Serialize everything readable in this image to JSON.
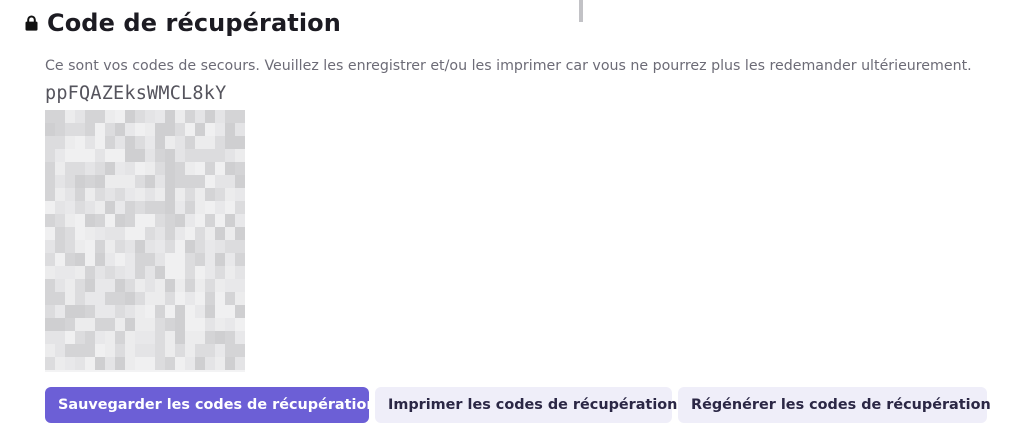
{
  "section": {
    "title": "Code de récupération",
    "description": "Ce sont vos codes de secours. Veuillez les enregistrer et/ou les imprimer car vous ne pourrez plus les redemander ultérieurement.",
    "visible_code": "ppFQAZEksWMCL8kY"
  },
  "actions": {
    "save_label": "Sauvegarder les codes de récupération",
    "print_label": "Imprimer les codes de récupération",
    "regenerate_label": "Régénérer les codes de récupération"
  },
  "colors": {
    "primary_button": "#6c5fd6",
    "secondary_button": "#efeef9",
    "title_text": "#1c1b22",
    "description_text": "#6c6b76"
  },
  "icons": {
    "heading_icon": "lock-icon"
  }
}
